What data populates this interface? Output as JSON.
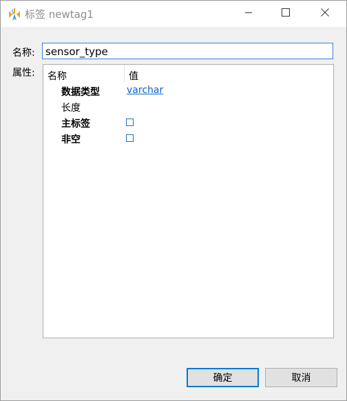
{
  "window": {
    "title": "标签 newtag1"
  },
  "form": {
    "name_label": "名称:",
    "name_value": "sensor_type",
    "props_label": "属性:"
  },
  "grid": {
    "header_name": "名称",
    "header_value": "值",
    "rows": [
      {
        "name": "数据类型",
        "bold": true,
        "value": "varchar",
        "kind": "link"
      },
      {
        "name": "长度",
        "bold": false,
        "value": "",
        "kind": "text"
      },
      {
        "name": "主标签",
        "bold": true,
        "checked": false,
        "kind": "checkbox"
      },
      {
        "name": "非空",
        "bold": true,
        "checked": false,
        "kind": "checkbox"
      }
    ]
  },
  "buttons": {
    "ok": "确定",
    "cancel": "取消"
  },
  "colors": {
    "accent": "#0078d7",
    "link": "#0b62c9",
    "title_text": "#8c8c8c",
    "dialog_bg": "#f0f0f0"
  },
  "icons": {
    "app": "kettle-app-icon",
    "minimize": "minimize-icon",
    "maximize": "maximize-icon",
    "close": "close-icon"
  }
}
